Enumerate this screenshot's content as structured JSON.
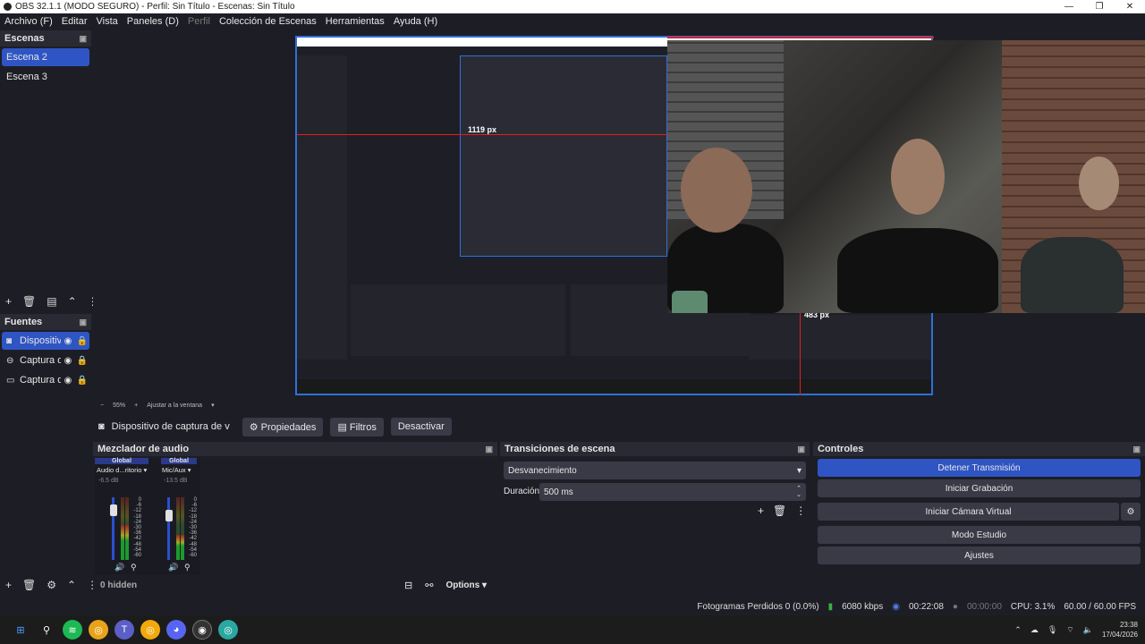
{
  "window": {
    "title": "OBS 32.1.1 (MODO SEGURO) - Perfil: Sin Título - Escenas: Sin Título"
  },
  "menu": [
    "Archivo (F)",
    "Editar",
    "Vista",
    "Paneles (D)",
    "Perfil",
    "Colección de Escenas",
    "Herramientas",
    "Ayuda (H)"
  ],
  "scenes": {
    "title": "Escenas",
    "items": [
      "Escena 2",
      "Escena 3"
    ]
  },
  "sources": {
    "title": "Fuentes",
    "items": [
      "Dispositiv",
      "Captura d",
      "Captura d"
    ]
  },
  "preview": {
    "label_h": "1119 px",
    "label_v": "483 px"
  },
  "zoom": {
    "minus": "−",
    "value": "55%",
    "plus": "+",
    "fit": "Ajustar a la ventana"
  },
  "source_bar": {
    "name": "Dispositivo de captura de v",
    "props": "Propiedades",
    "filters": "Filtros",
    "deactivate": "Desactivar"
  },
  "mixer": {
    "title": "Mezclador de audio",
    "channels": [
      {
        "scope": "Global",
        "name": "Audio d...ritorio",
        "db": "-6.5 dB",
        "level": 0.55
      },
      {
        "scope": "Global",
        "name": "Mic/Aux",
        "db": "-13.5 dB",
        "level": 0.4
      }
    ],
    "ticks": [
      "0",
      "-6",
      "-12",
      "-18",
      "-24",
      "-30",
      "-36",
      "-42",
      "-48",
      "-54",
      "-60"
    ],
    "hidden": "0 hidden",
    "options": "Options"
  },
  "transitions": {
    "title": "Transiciones de escena",
    "selected": "Desvanecimiento",
    "duration_label": "Duración",
    "duration_value": "500 ms"
  },
  "controls": {
    "title": "Controles",
    "stop_stream": "Detener Transmisión",
    "start_record": "Iniciar Grabación",
    "start_vcam": "Iniciar Cámara Virtual",
    "studio": "Modo Estudio",
    "settings": "Ajustes"
  },
  "status": {
    "dropped": "Fotogramas Perdidos 0 (0.0%)",
    "bitrate": "6080 kbps",
    "stream_time": "00:22:08",
    "rec_time": "00:00:00",
    "cpu": "CPU: 3.1%",
    "fps": "60.00 / 60.00 FPS"
  },
  "taskbar": {
    "time": "23:38",
    "date": "17/04/2026"
  },
  "colors": {
    "accent": "#2f55c4",
    "background": "#1d1e25",
    "panel": "#292a33",
    "red_guide": "#e02020"
  }
}
